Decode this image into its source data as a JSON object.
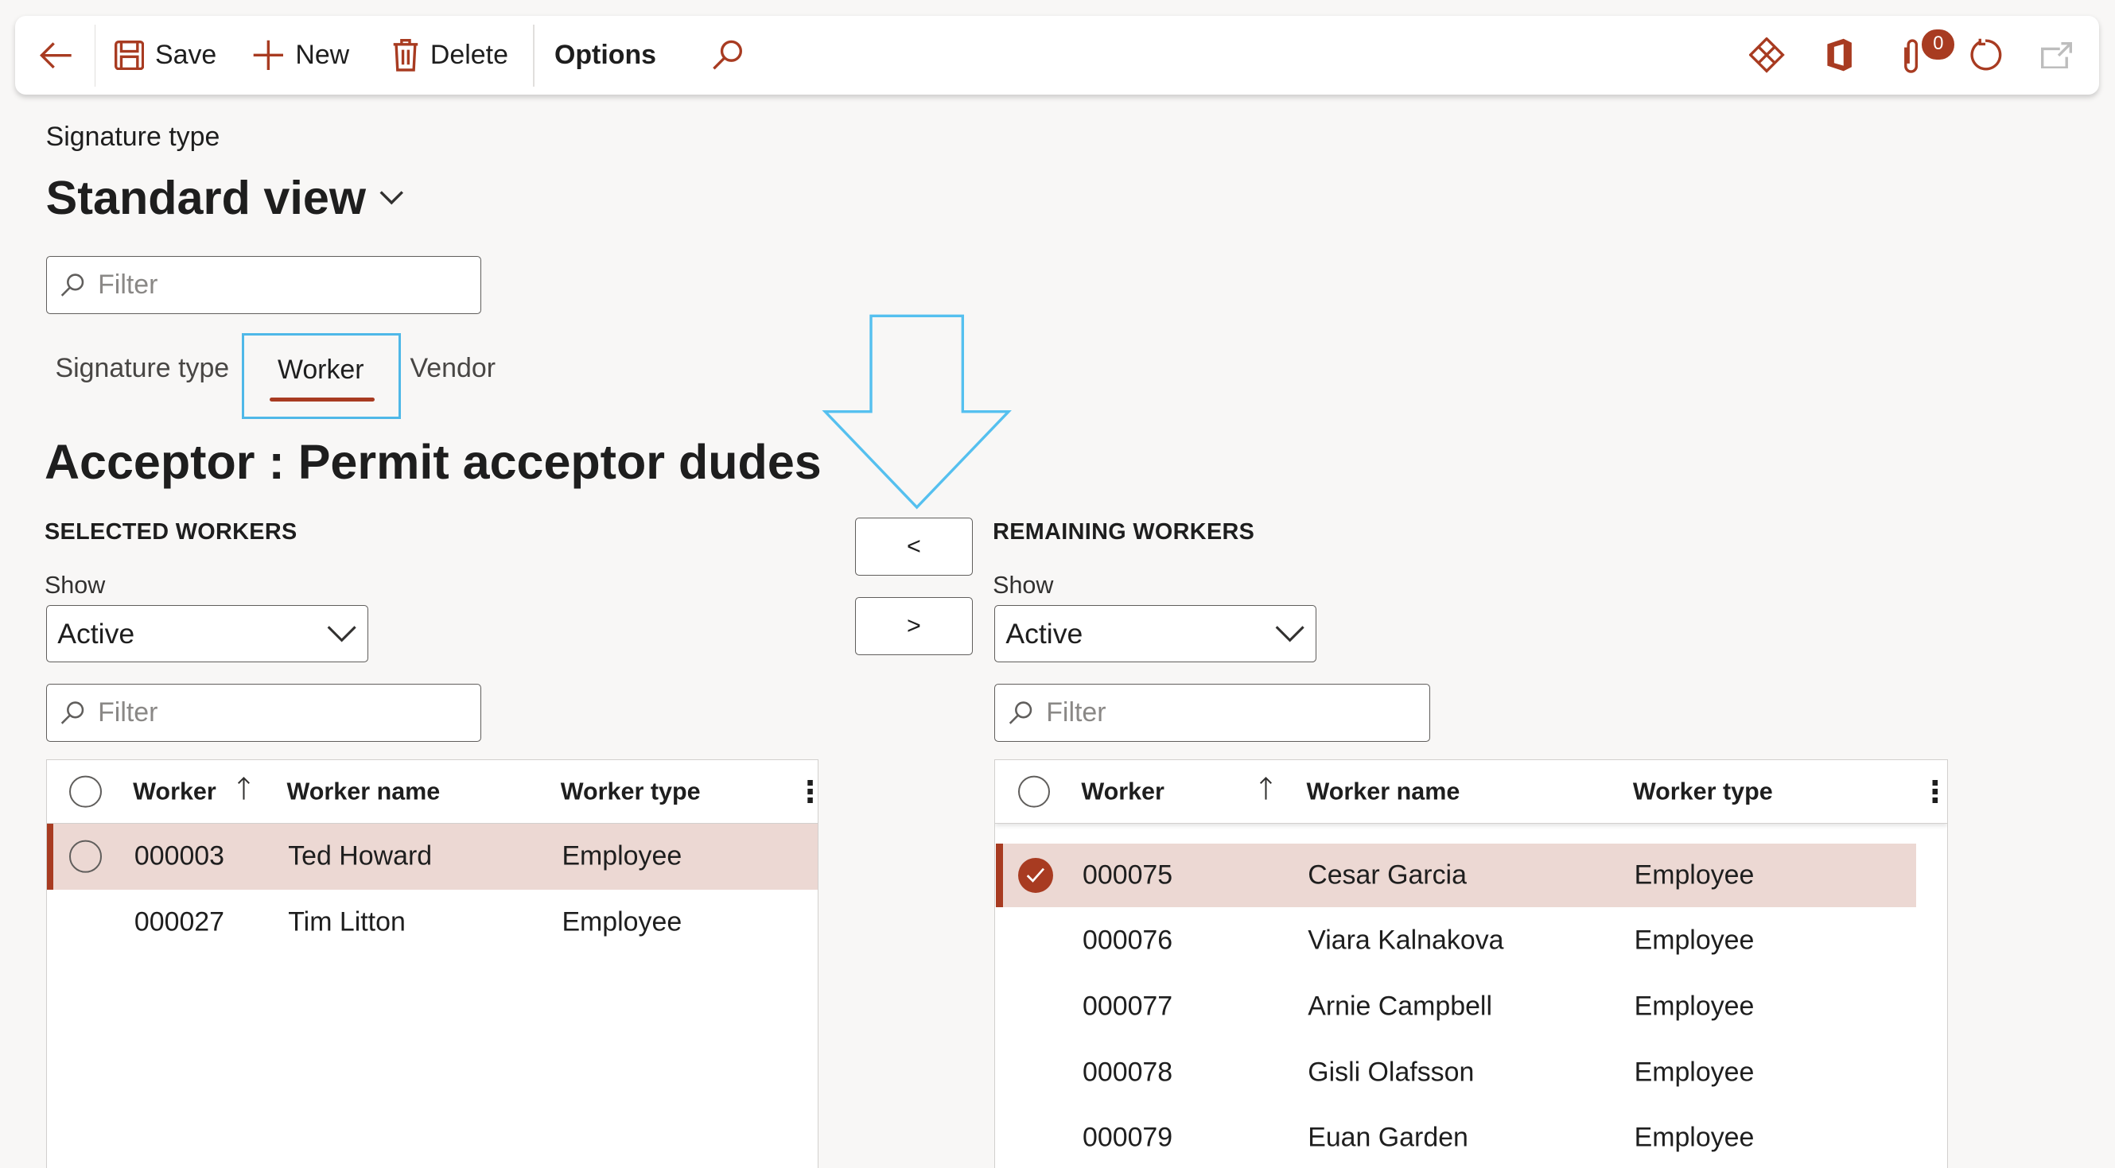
{
  "toolbar": {
    "save_label": "Save",
    "new_label": "New",
    "delete_label": "Delete",
    "options_label": "Options",
    "attachments_count": "0",
    "accent_color": "#a83b21"
  },
  "page": {
    "breadcrumb": "Signature type",
    "view_name": "Standard view",
    "filter_placeholder": "Filter",
    "tabs": [
      {
        "label": "Signature type"
      },
      {
        "label": "Worker",
        "selected": true
      },
      {
        "label": "Vendor"
      }
    ],
    "heading": "Acceptor : Permit acceptor dudes"
  },
  "transfer": {
    "add_label": "<",
    "remove_label": ">"
  },
  "selected": {
    "title": "SELECTED WORKERS",
    "show_label": "Show",
    "show_value": "Active",
    "filter_placeholder": "Filter",
    "columns": [
      "Worker",
      "Worker name",
      "Worker type"
    ],
    "rows": [
      {
        "worker": "000003",
        "name": "Ted Howard",
        "type": "Employee"
      },
      {
        "worker": "000027",
        "name": "Tim Litton",
        "type": "Employee"
      }
    ]
  },
  "remaining": {
    "title": "REMAINING WORKERS",
    "show_label": "Show",
    "show_value": "Active",
    "filter_placeholder": "Filter",
    "columns": [
      "Worker",
      "Worker name",
      "Worker type"
    ],
    "rows": [
      {
        "worker": "000075",
        "name": "Cesar Garcia",
        "type": "Employee"
      },
      {
        "worker": "000076",
        "name": "Viara Kalnakova",
        "type": "Employee"
      },
      {
        "worker": "000077",
        "name": "Arnie Campbell",
        "type": "Employee"
      },
      {
        "worker": "000078",
        "name": "Gisli Olafsson",
        "type": "Employee"
      },
      {
        "worker": "000079",
        "name": "Euan Garden",
        "type": "Employee"
      }
    ]
  }
}
